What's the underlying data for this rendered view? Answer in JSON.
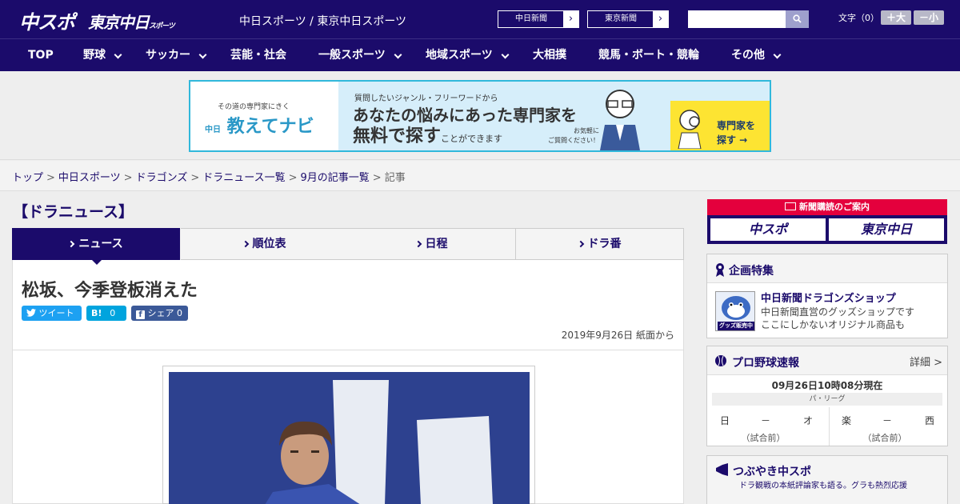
{
  "header": {
    "logo_chuspo": "中スポ",
    "logo_tokyo": "東京中日",
    "logo_tokyo_sub": "スポーツ",
    "site_title": "中日スポーツ / 東京中日スポーツ",
    "paper_buttons": [
      {
        "label": "中日新聞"
      },
      {
        "label": "東京新聞"
      }
    ],
    "search_placeholder": "",
    "font_size_label": "文字（0）",
    "font_bigger": "＋大",
    "font_smaller": "－小"
  },
  "nav": {
    "items": [
      {
        "label": "TOP",
        "has_caret": false
      },
      {
        "label": "野球",
        "has_caret": true
      },
      {
        "label": "サッカー",
        "has_caret": true
      },
      {
        "label": "芸能・社会",
        "has_caret": false
      },
      {
        "label": "一般スポーツ",
        "has_caret": true
      },
      {
        "label": "地域スポーツ",
        "has_caret": true
      },
      {
        "label": "大相撲",
        "has_caret": false
      },
      {
        "label": "競馬・ボート・競輪",
        "has_caret": false
      },
      {
        "label": "その他",
        "has_caret": true
      }
    ]
  },
  "banner": {
    "tagline": "その道の専門家にきく",
    "brand_prefix": "中日",
    "brand": "教えてナビ",
    "line1": "質問したいジャンル・フリーワードから",
    "line2": "あなたの悩みにあった専門家を",
    "line3_big": "無料で探す",
    "line3_small": "ことができます",
    "aside": "お気軽に\nご質問ください！",
    "cta": "専門家を\n探す →"
  },
  "breadcrumb": {
    "items": [
      "トップ",
      "中日スポーツ",
      "ドラゴンズ",
      "ドラニュース一覧",
      "9月の記事一覧"
    ],
    "current": "記事",
    "separator": ">"
  },
  "main": {
    "section_heading": "【ドラニュース】",
    "tabs": [
      {
        "label": "ニュース",
        "active": true
      },
      {
        "label": "順位表",
        "active": false
      },
      {
        "label": "日程",
        "active": false
      },
      {
        "label": "ドラ番",
        "active": false
      }
    ],
    "headline": "松坂、今季登板消えた",
    "share": {
      "tweet": "ツイート",
      "hatena_count": "0",
      "facebook": "シェア",
      "facebook_count": "0"
    },
    "dateline": "2019年9月26日 紙面から"
  },
  "sidebar": {
    "subscription_title": "新聞購読のご案内",
    "subscription_logos": [
      "中スポ",
      "東京中日"
    ],
    "feature": {
      "title": "企画特集",
      "shop_title": "中日新聞ドラゴンズショップ",
      "shop_desc_1": "中日新聞直営のグッズショップです",
      "shop_desc_2": "ここにしかないオリジナル商品も",
      "thumb_label": "グッズ販売中"
    },
    "scores": {
      "title": "プロ野球速報",
      "detail": "詳細 >",
      "time": "09月26日10時08分現在",
      "league": "パ・リーグ",
      "games": [
        {
          "team1": "日",
          "vs": "－",
          "team2": "オ",
          "status": "（試合前）"
        },
        {
          "team1": "楽",
          "vs": "－",
          "team2": "西",
          "status": "（試合前）"
        }
      ]
    },
    "tsubuyaki": {
      "title": "つぶやき中スポ",
      "subtitle": "ドラ観戦の本紙評論家も語る。グラも熱烈応援"
    }
  },
  "colors": {
    "brand_navy": "#1b0b6b",
    "subscription_red": "#e4003d",
    "banner_border": "#31b8db",
    "twitter": "#1da1f2",
    "hatena": "#00a4de",
    "facebook": "#3b5998"
  }
}
